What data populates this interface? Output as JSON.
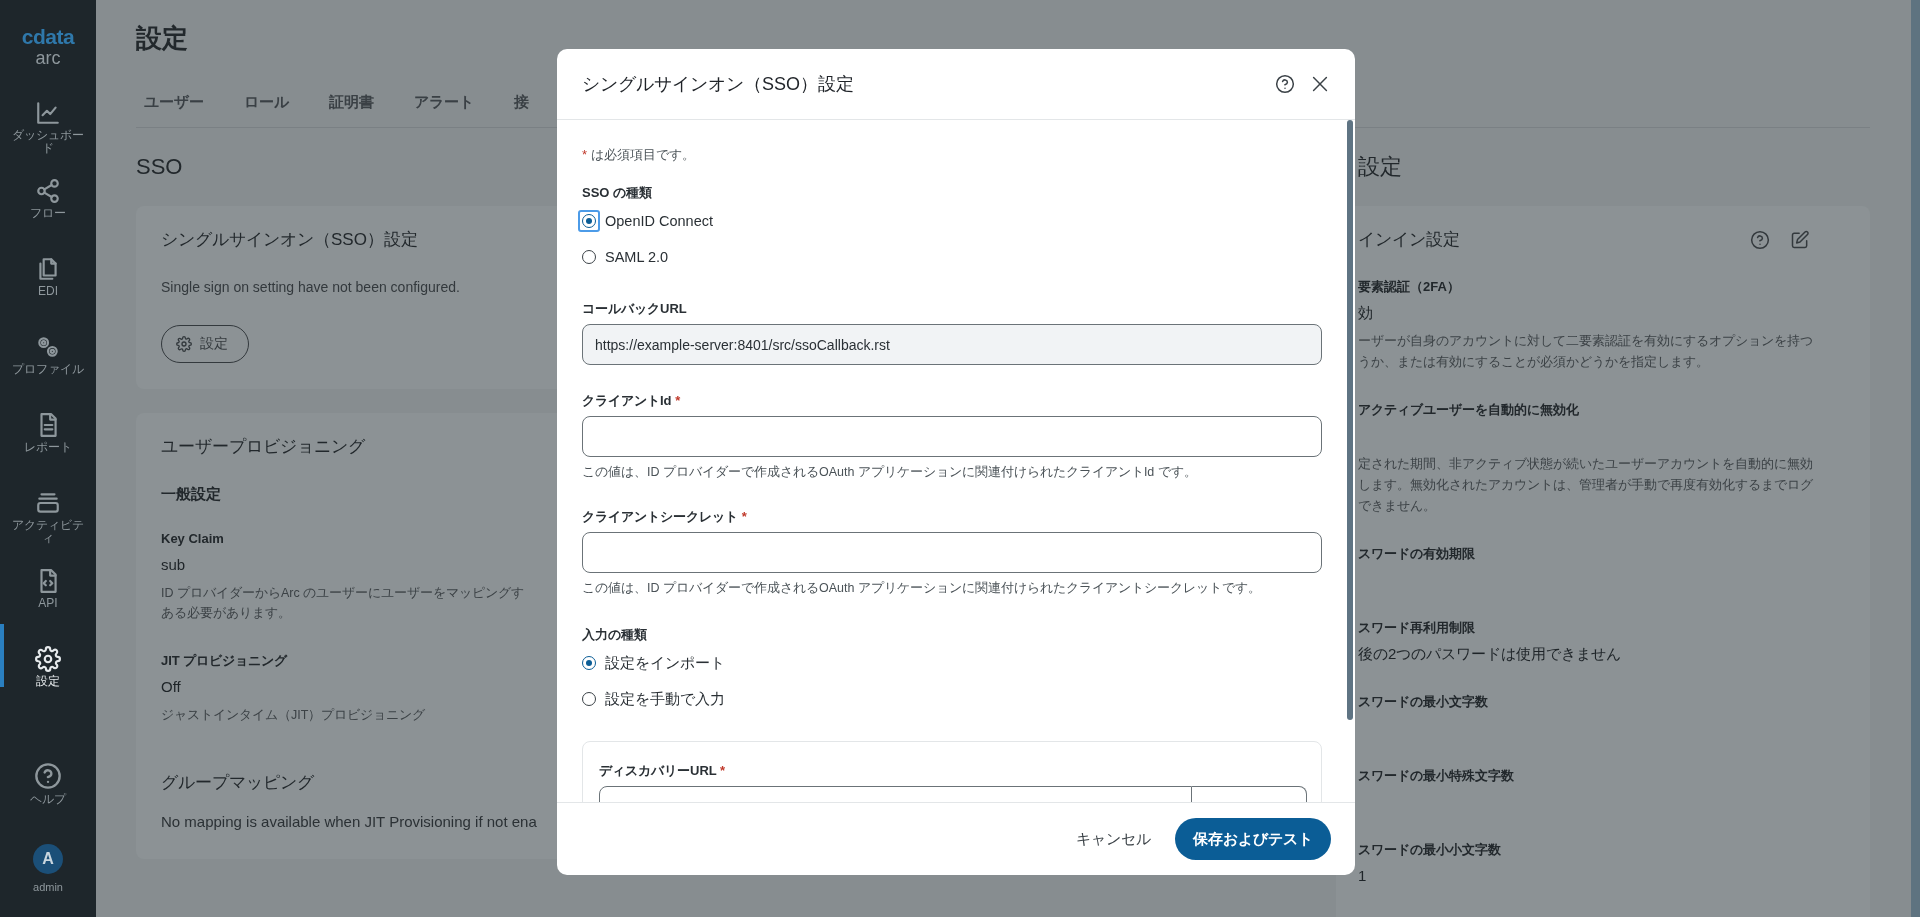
{
  "sidebar": {
    "logo": {
      "brand": "cdata",
      "product": "arc"
    },
    "items": [
      {
        "label": "ダッシュボード",
        "selected": false
      },
      {
        "label": "フロー",
        "selected": false
      },
      {
        "label": "EDI",
        "selected": false
      },
      {
        "label": "プロファイル",
        "selected": false
      },
      {
        "label": "レポート",
        "selected": false
      },
      {
        "label": "アクティビティ",
        "selected": false
      },
      {
        "label": "API",
        "selected": false
      },
      {
        "label": "設定",
        "selected": true
      }
    ],
    "help": {
      "label": "ヘルプ"
    },
    "user": {
      "initial": "A",
      "name": "admin"
    }
  },
  "page": {
    "title": "設定",
    "tabs": [
      {
        "label": "ユーザー",
        "selected": false
      },
      {
        "label": "ロール",
        "selected": false
      },
      {
        "label": "証明書",
        "selected": false
      },
      {
        "label": "アラート",
        "selected": false
      },
      {
        "label": "接",
        "selected": false
      }
    ]
  },
  "sso_section": {
    "heading": "SSO",
    "card": {
      "title": "シングルサインオン（SSO）設定",
      "message": "Single sign on setting have not been configured.",
      "button": "設定"
    }
  },
  "provisioning_card": {
    "title": "ユーザープロビジョニング",
    "subheading": "一般設定",
    "fields": [
      {
        "label": "Key Claim",
        "value": "sub",
        "description_lines": [
          "ID プロバイダーからArc のユーザーにユーザーをマッピングす",
          "ある必要があります。"
        ]
      },
      {
        "label": "JIT プロビジョニング",
        "value": "Off",
        "description_lines": [
          "ジャストインタイム（JIT）プロビジョニング"
        ]
      }
    ],
    "group_mapping": {
      "title": "グループマッピング",
      "message": "No mapping is available when JIT Provisioning if not ena"
    }
  },
  "right_section": {
    "heading": "設定",
    "card": {
      "title": "インイン設定",
      "fields": [
        {
          "label": "要素認証（2FA）",
          "value": "効",
          "description_lines": [
            "ーザーが自身のアカウントに対して二要素認証を有効にするオプションを持つ",
            "うか、または有効にすることが必須かどうかを指定します。"
          ]
        },
        {
          "label": "アクティブユーザーを自動的に無効化",
          "description_lines": [
            "定された期間、非アクティブ状態が続いたユーザーアカウントを自動的に無効",
            "します。無効化されたアカウントは、管理者が手動で再度有効化するまでログ",
            "できません。"
          ]
        },
        {
          "label": "スワードの有効期限"
        },
        {
          "label": "スワード再利用制限",
          "value": "後の2つのパスワードは使用できません"
        },
        {
          "label": "スワードの最小文字数"
        },
        {
          "label": "スワードの最小特殊文字数"
        },
        {
          "label": "スワードの最小小文字数",
          "value": "1"
        }
      ]
    }
  },
  "dialog": {
    "title": "シングルサインオン（SSO）設定",
    "required_note": {
      "mark": "*",
      "text": "は必須項目です。"
    },
    "sso_type": {
      "label": "SSO の種類",
      "options": [
        {
          "label": "OpenID Connect",
          "selected": true,
          "focused": true
        },
        {
          "label": "SAML 2.0",
          "selected": false,
          "focused": false
        }
      ]
    },
    "callback_url": {
      "label": "コールバックURL",
      "value": "https://example-server:8401/src/ssoCallback.rst"
    },
    "client_id": {
      "label": "クライアントId",
      "required_mark": "*",
      "helper": "この値は、ID プロバイダーで作成されるOAuth アプリケーションに関連付けられたクライアントId です。"
    },
    "client_secret": {
      "label": "クライアントシークレット",
      "required_mark": "*",
      "helper": "この値は、ID プロバイダーで作成されるOAuth アプリケーションに関連付けられたクライアントシークレットです。"
    },
    "input_type": {
      "label": "入力の種類",
      "options": [
        {
          "label": "設定をインポート",
          "selected": true,
          "focused": false
        },
        {
          "label": "設定を手動で入力",
          "selected": false,
          "focused": false
        }
      ]
    },
    "discovery_url": {
      "label": "ディスカバリーURL",
      "required_mark": "*"
    },
    "buttons": {
      "cancel": "キャンセル",
      "primary": "保存およびテスト"
    }
  }
}
